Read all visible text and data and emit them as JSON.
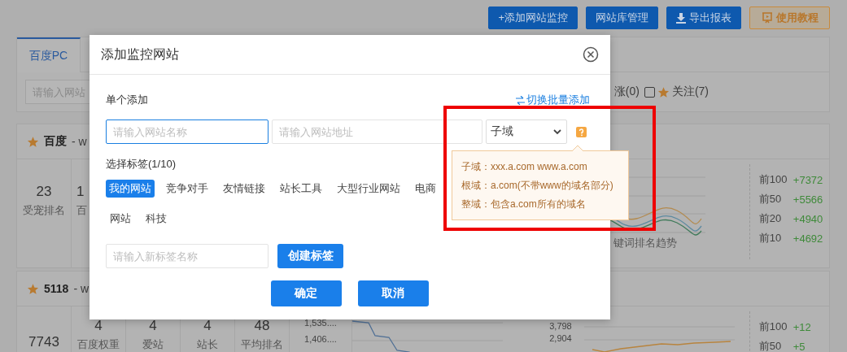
{
  "toolbar": {
    "buttons": [
      {
        "label": "+添加网站监控",
        "kind": "primary"
      },
      {
        "label": "网站库管理",
        "kind": "primary"
      },
      {
        "label": "导出报表",
        "kind": "download"
      },
      {
        "label": "使用教程",
        "kind": "tutorial"
      }
    ]
  },
  "panel": {
    "tabs": [
      {
        "label": "百度PC",
        "selected": true
      }
    ],
    "search": {
      "placeholder": "请输入网站"
    },
    "filters": [
      {
        "label": "涨(0)",
        "kind": "text"
      },
      {
        "label": "关注(7)",
        "kind": "star-checkbox",
        "checked": false
      }
    ]
  },
  "cards": [
    {
      "name": "百度",
      "domain": "- w",
      "starred": true,
      "stats": [
        {
          "value": "23",
          "label": "受宠排名"
        },
        {
          "value": "1",
          "label": "百"
        }
      ],
      "chart_caption": "键词排名趋势",
      "ranks": [
        {
          "label": "前100",
          "value": "+7372"
        },
        {
          "label": "前50",
          "value": "+5566"
        },
        {
          "label": "前20",
          "value": "+4940"
        },
        {
          "label": "前10",
          "value": "+4692"
        }
      ]
    },
    {
      "name": "5118",
      "domain": "- w",
      "starred": true,
      "stats": [
        {
          "value": "7743"
        },
        {
          "value": "4",
          "label": "百度权重"
        },
        {
          "value": "4",
          "label": "爱站"
        },
        {
          "value": "4",
          "label": "站长"
        },
        {
          "value": "48",
          "label": "平均排名"
        }
      ],
      "traffic": [
        "1,535....",
        "1,406...."
      ],
      "axis_labels": [
        "3,798",
        "2,904"
      ],
      "ranks": [
        {
          "label": "前100",
          "value": "+12"
        },
        {
          "label": "前50",
          "value": "+5"
        }
      ]
    }
  ],
  "dialog": {
    "title": "添加监控网站",
    "section": "单个添加",
    "switch_link": "切换批量添加",
    "name_field": {
      "placeholder": "请输入网站名称",
      "focused": true
    },
    "url_field": {
      "placeholder": "请输入网站地址",
      "focused": false
    },
    "domain_select": {
      "value": "子域"
    },
    "tags_title": "选择标签(1/10)",
    "tag_rows": [
      [
        {
          "label": "我的网站",
          "selected": true
        },
        {
          "label": "竞争对手",
          "selected": false
        },
        {
          "label": "友情链接",
          "selected": false
        },
        {
          "label": "站长工具",
          "selected": false
        },
        {
          "label": "大型行业网站",
          "selected": false
        },
        {
          "label": "电商",
          "selected": false
        }
      ],
      [
        {
          "label": "网站",
          "selected": false
        },
        {
          "label": "科技",
          "selected": false
        }
      ]
    ],
    "new_tag_field": {
      "placeholder": "请输入新标签名称"
    },
    "create_button": "创建标签",
    "buttons": [
      {
        "label": "确定"
      },
      {
        "label": "取消"
      }
    ]
  },
  "tooltip": {
    "lines": [
      "子域：xxx.a.com www.a.com",
      "根域：a.com(不带www的域名部分)",
      "整域：包含a.com所有的域名"
    ]
  }
}
